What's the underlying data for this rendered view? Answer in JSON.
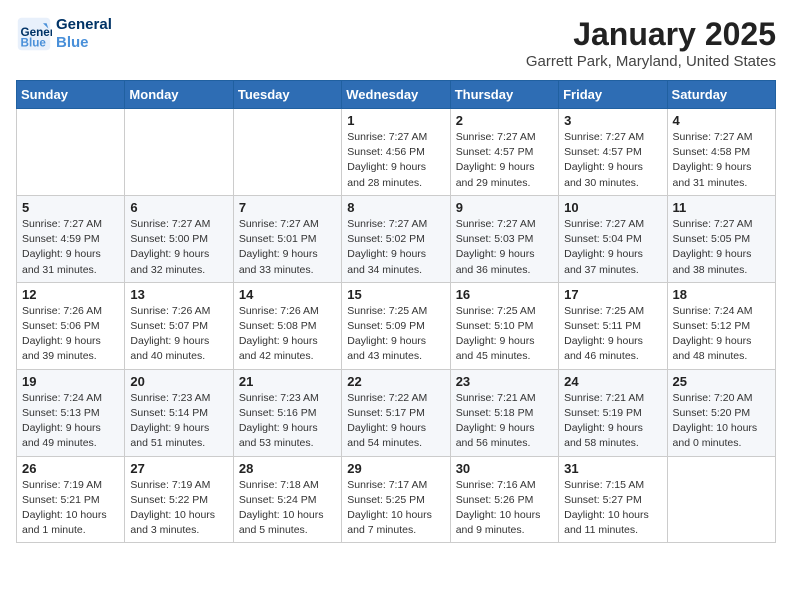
{
  "header": {
    "logo_line1": "General",
    "logo_line2": "Blue",
    "month": "January 2025",
    "location": "Garrett Park, Maryland, United States"
  },
  "weekdays": [
    "Sunday",
    "Monday",
    "Tuesday",
    "Wednesday",
    "Thursday",
    "Friday",
    "Saturday"
  ],
  "weeks": [
    [
      {
        "day": "",
        "info": ""
      },
      {
        "day": "",
        "info": ""
      },
      {
        "day": "",
        "info": ""
      },
      {
        "day": "1",
        "info": "Sunrise: 7:27 AM\nSunset: 4:56 PM\nDaylight: 9 hours\nand 28 minutes."
      },
      {
        "day": "2",
        "info": "Sunrise: 7:27 AM\nSunset: 4:57 PM\nDaylight: 9 hours\nand 29 minutes."
      },
      {
        "day": "3",
        "info": "Sunrise: 7:27 AM\nSunset: 4:57 PM\nDaylight: 9 hours\nand 30 minutes."
      },
      {
        "day": "4",
        "info": "Sunrise: 7:27 AM\nSunset: 4:58 PM\nDaylight: 9 hours\nand 31 minutes."
      }
    ],
    [
      {
        "day": "5",
        "info": "Sunrise: 7:27 AM\nSunset: 4:59 PM\nDaylight: 9 hours\nand 31 minutes."
      },
      {
        "day": "6",
        "info": "Sunrise: 7:27 AM\nSunset: 5:00 PM\nDaylight: 9 hours\nand 32 minutes."
      },
      {
        "day": "7",
        "info": "Sunrise: 7:27 AM\nSunset: 5:01 PM\nDaylight: 9 hours\nand 33 minutes."
      },
      {
        "day": "8",
        "info": "Sunrise: 7:27 AM\nSunset: 5:02 PM\nDaylight: 9 hours\nand 34 minutes."
      },
      {
        "day": "9",
        "info": "Sunrise: 7:27 AM\nSunset: 5:03 PM\nDaylight: 9 hours\nand 36 minutes."
      },
      {
        "day": "10",
        "info": "Sunrise: 7:27 AM\nSunset: 5:04 PM\nDaylight: 9 hours\nand 37 minutes."
      },
      {
        "day": "11",
        "info": "Sunrise: 7:27 AM\nSunset: 5:05 PM\nDaylight: 9 hours\nand 38 minutes."
      }
    ],
    [
      {
        "day": "12",
        "info": "Sunrise: 7:26 AM\nSunset: 5:06 PM\nDaylight: 9 hours\nand 39 minutes."
      },
      {
        "day": "13",
        "info": "Sunrise: 7:26 AM\nSunset: 5:07 PM\nDaylight: 9 hours\nand 40 minutes."
      },
      {
        "day": "14",
        "info": "Sunrise: 7:26 AM\nSunset: 5:08 PM\nDaylight: 9 hours\nand 42 minutes."
      },
      {
        "day": "15",
        "info": "Sunrise: 7:25 AM\nSunset: 5:09 PM\nDaylight: 9 hours\nand 43 minutes."
      },
      {
        "day": "16",
        "info": "Sunrise: 7:25 AM\nSunset: 5:10 PM\nDaylight: 9 hours\nand 45 minutes."
      },
      {
        "day": "17",
        "info": "Sunrise: 7:25 AM\nSunset: 5:11 PM\nDaylight: 9 hours\nand 46 minutes."
      },
      {
        "day": "18",
        "info": "Sunrise: 7:24 AM\nSunset: 5:12 PM\nDaylight: 9 hours\nand 48 minutes."
      }
    ],
    [
      {
        "day": "19",
        "info": "Sunrise: 7:24 AM\nSunset: 5:13 PM\nDaylight: 9 hours\nand 49 minutes."
      },
      {
        "day": "20",
        "info": "Sunrise: 7:23 AM\nSunset: 5:14 PM\nDaylight: 9 hours\nand 51 minutes."
      },
      {
        "day": "21",
        "info": "Sunrise: 7:23 AM\nSunset: 5:16 PM\nDaylight: 9 hours\nand 53 minutes."
      },
      {
        "day": "22",
        "info": "Sunrise: 7:22 AM\nSunset: 5:17 PM\nDaylight: 9 hours\nand 54 minutes."
      },
      {
        "day": "23",
        "info": "Sunrise: 7:21 AM\nSunset: 5:18 PM\nDaylight: 9 hours\nand 56 minutes."
      },
      {
        "day": "24",
        "info": "Sunrise: 7:21 AM\nSunset: 5:19 PM\nDaylight: 9 hours\nand 58 minutes."
      },
      {
        "day": "25",
        "info": "Sunrise: 7:20 AM\nSunset: 5:20 PM\nDaylight: 10 hours\nand 0 minutes."
      }
    ],
    [
      {
        "day": "26",
        "info": "Sunrise: 7:19 AM\nSunset: 5:21 PM\nDaylight: 10 hours\nand 1 minute."
      },
      {
        "day": "27",
        "info": "Sunrise: 7:19 AM\nSunset: 5:22 PM\nDaylight: 10 hours\nand 3 minutes."
      },
      {
        "day": "28",
        "info": "Sunrise: 7:18 AM\nSunset: 5:24 PM\nDaylight: 10 hours\nand 5 minutes."
      },
      {
        "day": "29",
        "info": "Sunrise: 7:17 AM\nSunset: 5:25 PM\nDaylight: 10 hours\nand 7 minutes."
      },
      {
        "day": "30",
        "info": "Sunrise: 7:16 AM\nSunset: 5:26 PM\nDaylight: 10 hours\nand 9 minutes."
      },
      {
        "day": "31",
        "info": "Sunrise: 7:15 AM\nSunset: 5:27 PM\nDaylight: 10 hours\nand 11 minutes."
      },
      {
        "day": "",
        "info": ""
      }
    ]
  ]
}
